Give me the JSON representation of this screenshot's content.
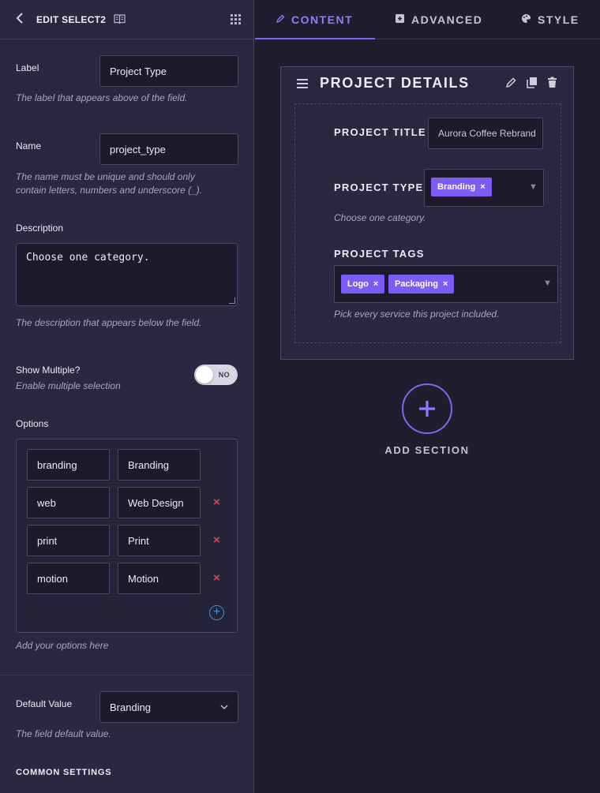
{
  "left_panel": {
    "header": {
      "title": "EDIT SELECT2"
    },
    "label_field": {
      "label": "Label",
      "value": "Project Type",
      "help": "The label that appears above of the field."
    },
    "name_field": {
      "label": "Name",
      "value": "project_type",
      "help_line1": "The name must be unique and should only",
      "help_line2": "contain letters, numbers and underscore (_)."
    },
    "description_field": {
      "label": "Description",
      "value": "Choose one category.",
      "help": "The description that appears below the field."
    },
    "show_multiple": {
      "label": "Show Multiple?",
      "help": "Enable multiple selection",
      "toggle_text": "NO",
      "enabled": false
    },
    "options": {
      "label": "Options",
      "rows": [
        {
          "value": "branding",
          "label": "Branding",
          "deletable": false
        },
        {
          "value": "web",
          "label": "Web Design",
          "deletable": true
        },
        {
          "value": "print",
          "label": "Print",
          "deletable": true
        },
        {
          "value": "motion",
          "label": "Motion",
          "deletable": true
        }
      ],
      "delete_glyph": "×",
      "add_glyph": "+",
      "help": "Add your options here"
    },
    "default_value": {
      "label": "Default Value",
      "value": "Branding",
      "help": "The field default value."
    },
    "common_settings": "COMMON SETTINGS"
  },
  "tabs": [
    {
      "label": "CONTENT",
      "icon": "pencil-icon",
      "active": true
    },
    {
      "label": "ADVANCED",
      "icon": "layout-icon",
      "active": false
    },
    {
      "label": "STYLE",
      "icon": "palette-icon",
      "active": false
    }
  ],
  "section": {
    "title": "PROJECT DETAILS",
    "fields": {
      "title": {
        "label": "PROJECT TITLE",
        "value": "Aurora Coffee Rebrand"
      },
      "type": {
        "label": "PROJECT TYPE",
        "chips": [
          "Branding"
        ],
        "help": "Choose one category."
      },
      "tags": {
        "label": "PROJECT TAGS",
        "chips": [
          "Logo",
          "Packaging"
        ],
        "help": "Pick every service this project included."
      }
    }
  },
  "add_section": {
    "label": "ADD SECTION"
  },
  "colors": {
    "accent": "#7b6af0",
    "chip": "#7b5cf5",
    "panel": "#2a2840",
    "background": "#1f1d2e",
    "danger": "#e04848",
    "add_blue": "#3d8fd6"
  }
}
